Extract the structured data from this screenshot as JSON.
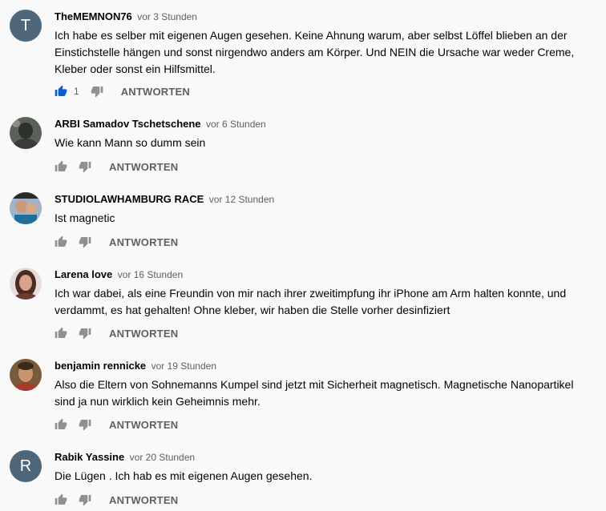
{
  "reply_label": "ANTWORTEN",
  "colors": {
    "liked": "#065fd4",
    "icon": "#909090",
    "letter_avatar": "#4e6677"
  },
  "comments": [
    {
      "author": "TheMEMNON76",
      "time": "vor 3 Stunden",
      "text": "Ich habe es selber mit eigenen Augen gesehen. Keine Ahnung warum, aber selbst Löffel blieben an der Einstichstelle hängen und sonst nirgendwo anders am Körper. Und NEIN die Ursache war weder Creme, Kleber oder sonst ein Hilfsmittel.",
      "likes": "1",
      "avatar_letter": "T"
    },
    {
      "author": "ARBI Samadov Tschetschene",
      "time": "vor 6 Stunden",
      "text": "Wie kann Mann so dumm  sein"
    },
    {
      "author": "STUDIOLAWHAMBURG RACE",
      "time": "vor 12 Stunden",
      "text": "Ist magnetic"
    },
    {
      "author": "Larena love",
      "time": "vor 16 Stunden",
      "text": "Ich war dabei, als eine Freundin von mir nach ihrer zweitimpfung ihr iPhone am Arm halten konnte, und verdammt, es hat gehalten! Ohne kleber, wir haben die Stelle vorher desinfiziert"
    },
    {
      "author": "benjamin rennicke",
      "time": "vor 19 Stunden",
      "text": "Also die Eltern von Sohnemanns Kumpel sind jetzt mit Sicherheit magnetisch. Magnetische Nanopartikel sind ja nun wirklich kein Geheimnis mehr."
    },
    {
      "author": "Rabik Yassine",
      "time": "vor 20 Stunden",
      "text": "Die Lügen . Ich hab es mit eigenen Augen gesehen.",
      "avatar_letter": "R"
    }
  ]
}
